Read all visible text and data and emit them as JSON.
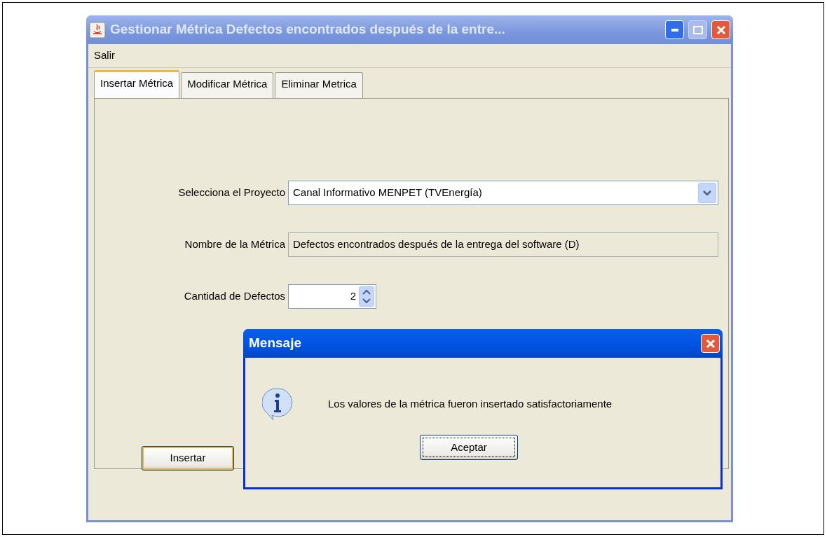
{
  "window": {
    "title": "Gestionar Métrica Defectos encontrados después de la entre...",
    "active": false,
    "maximize_enabled": false
  },
  "menu": [
    "Salir"
  ],
  "tabs": [
    {
      "label": "Insertar Métrica",
      "selected": true
    },
    {
      "label": "Modificar Métrica",
      "selected": false
    },
    {
      "label": "Eliminar Metrica",
      "selected": false
    }
  ],
  "form": {
    "fields": [
      {
        "kind": "combo",
        "label": "Selecciona el Proyecto",
        "value": "Canal Informativo MENPET (TVEnergía)",
        "editable": true
      },
      {
        "kind": "text",
        "label": "Nombre de la Métrica",
        "value": "Defectos encontrados después de la entrega del software (D)",
        "editable": false
      },
      {
        "kind": "spinner",
        "label": "Cantidad de Defectos",
        "value": "2",
        "editable": true
      }
    ],
    "button": {
      "label": "Insertar",
      "highlighted": true
    }
  },
  "dialog": {
    "title": "Mensaje",
    "message": "Los valores de la métrica fueron insertado satisfactoriamente",
    "button": {
      "label": "Aceptar",
      "focused": true
    }
  }
}
